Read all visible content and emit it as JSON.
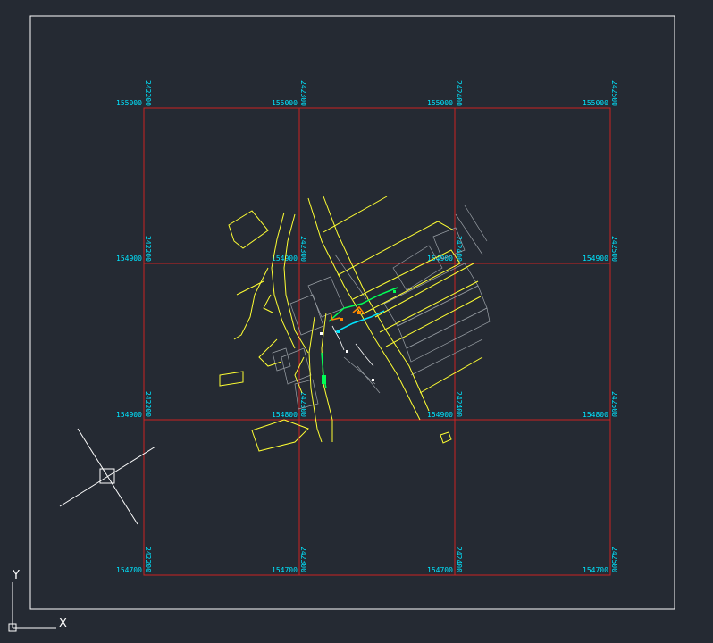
{
  "colors": {
    "background": "#252a33",
    "sheet_border": "#ffffff",
    "grid": "#cc2222",
    "labels": "#00e5ff",
    "roads": "#ffff33",
    "parcels": "#9aa0a6",
    "pipes": "#00ff55",
    "markers": "#ff8800"
  },
  "grid": {
    "top_labels": [
      "155000",
      "155000",
      "155000",
      "155000"
    ],
    "rows": [
      {
        "left_label": "154900",
        "cell_labels": [
          "154900",
          "154900",
          "154900"
        ]
      },
      {
        "left_label": "154900",
        "cell_labels": [
          "154800",
          "154900",
          "154800"
        ]
      },
      {
        "left_label": "154700",
        "cell_labels": [
          "154700",
          "154700",
          "154700"
        ]
      }
    ],
    "column_labels": [
      "242200",
      "242300",
      "242400",
      "242500"
    ]
  },
  "ucs": {
    "x_label": "X",
    "y_label": "Y"
  },
  "icons": {
    "ucs": "ucs-axis-icon",
    "cursor": "crosshair-cursor-icon",
    "drawing": "survey-drawing-icon"
  }
}
